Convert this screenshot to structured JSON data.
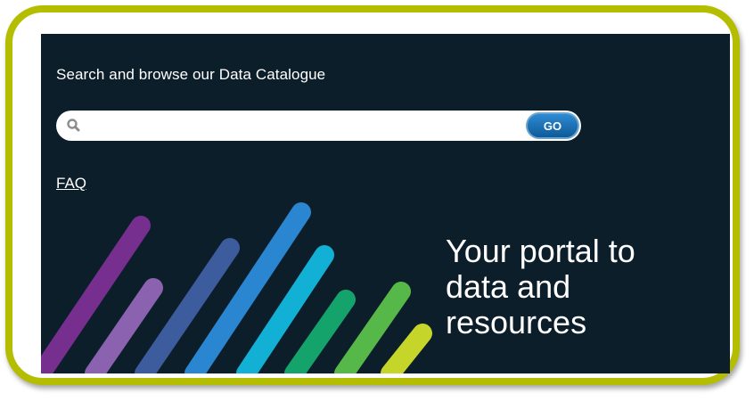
{
  "intro_text": "Search and browse our Data Catalogue",
  "search": {
    "value": "",
    "placeholder": "",
    "go_label": "GO"
  },
  "faq_label": "FAQ",
  "tagline": {
    "line1": "Your portal to",
    "line2": "data and",
    "line3": "resources"
  },
  "colors": {
    "frame_border": "#b5bd00",
    "panel_background": "#0d1e2b",
    "go_button": "#1e74bb",
    "stripes": [
      "#772f8f",
      "#8a62b0",
      "#3c5c9e",
      "#2a86d0",
      "#11b0d4",
      "#14a36b",
      "#55b848",
      "#c6d52a"
    ]
  },
  "icons": [
    "search-icon"
  ]
}
